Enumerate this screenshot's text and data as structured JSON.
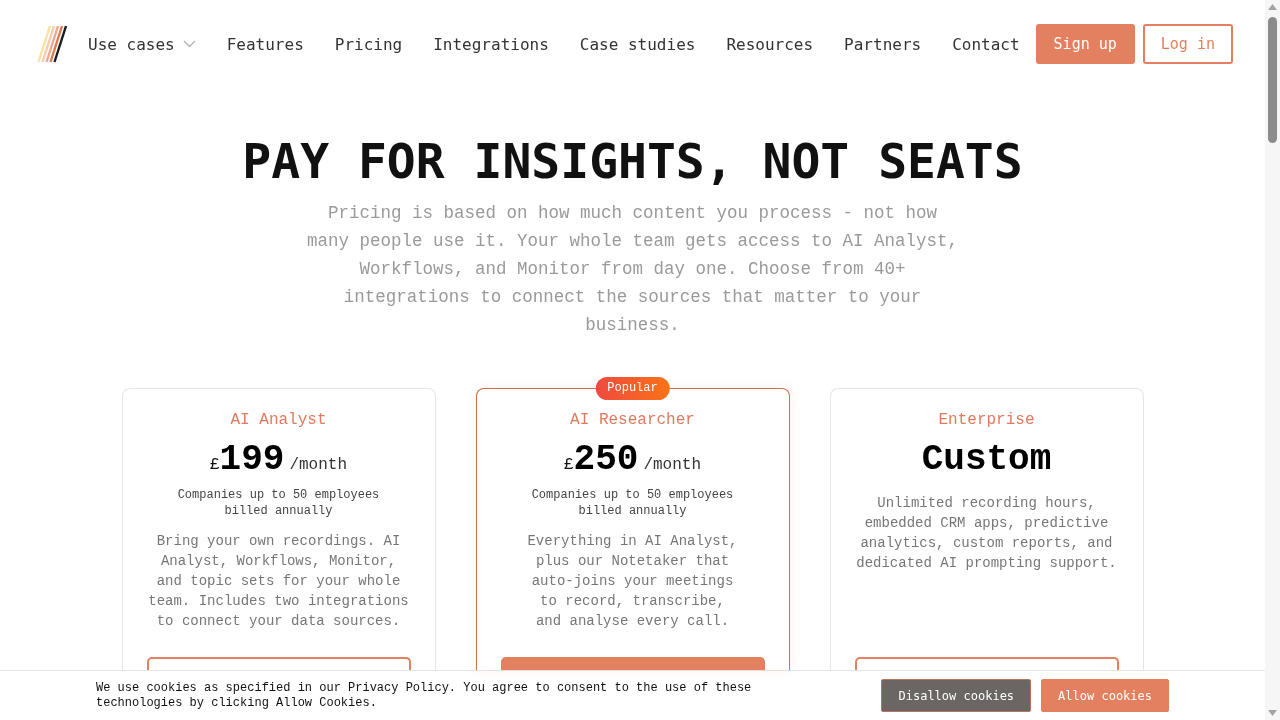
{
  "nav": {
    "items": [
      {
        "label": "Use cases",
        "kind": "dropdown"
      },
      {
        "label": "Features",
        "kind": "link"
      },
      {
        "label": "Pricing",
        "kind": "link"
      },
      {
        "label": "Integrations",
        "kind": "link"
      },
      {
        "label": "Case studies",
        "kind": "link"
      },
      {
        "label": "Resources",
        "kind": "link"
      },
      {
        "label": "Partners",
        "kind": "link"
      },
      {
        "label": "Contact",
        "kind": "link"
      }
    ],
    "buttons": [
      {
        "label": "Sign up",
        "kind": "primary"
      },
      {
        "label": "Log in",
        "kind": "outline"
      }
    ]
  },
  "hero": {
    "title": "PAY FOR INSIGHTS, NOT SEATS",
    "subtitle": "Pricing is based on how much content you process - not how many people use it. Your whole team gets access to AI Analyst, Workflows, and Monitor from day one. Choose from 40+ integrations to connect the sources that matter to your business."
  },
  "plans": [
    {
      "name": "AI Analyst",
      "currency": "£",
      "amount": "199",
      "period": "/month",
      "terms": [
        "Companies up to 50 employees",
        "billed annually"
      ],
      "description": "Bring your own recordings. AI Analyst, Workflows, Monitor, and topic sets for your whole team. Includes two integrations to connect your data sources.",
      "featured": false,
      "cta": {
        "kind": "outline"
      }
    },
    {
      "badge": "Popular",
      "name": "AI Researcher",
      "currency": "£",
      "amount": "250",
      "period": "/month",
      "terms": [
        "Companies up to 50 employees",
        "billed annually"
      ],
      "description": "Everything in AI Analyst, plus our Notetaker that auto-joins your meetings to record, transcribe, and analyse every call.",
      "featured": true,
      "cta": {
        "kind": "filled"
      }
    },
    {
      "name": "Enterprise",
      "amount": "Custom",
      "description": "Unlimited recording hours, embedded CRM apps, predictive analytics, custom reports, and dedicated AI prompting support.",
      "featured": false,
      "cta": {
        "kind": "outline"
      }
    }
  ],
  "cookie_banner": {
    "text": "We use cookies as specified in our Privacy Policy. You agree to consent to the use of these technologies by clicking Allow Cookies.",
    "buttons": [
      {
        "label": "Disallow cookies",
        "kind": "secondary"
      },
      {
        "label": "Allow cookies",
        "kind": "primary"
      }
    ]
  }
}
